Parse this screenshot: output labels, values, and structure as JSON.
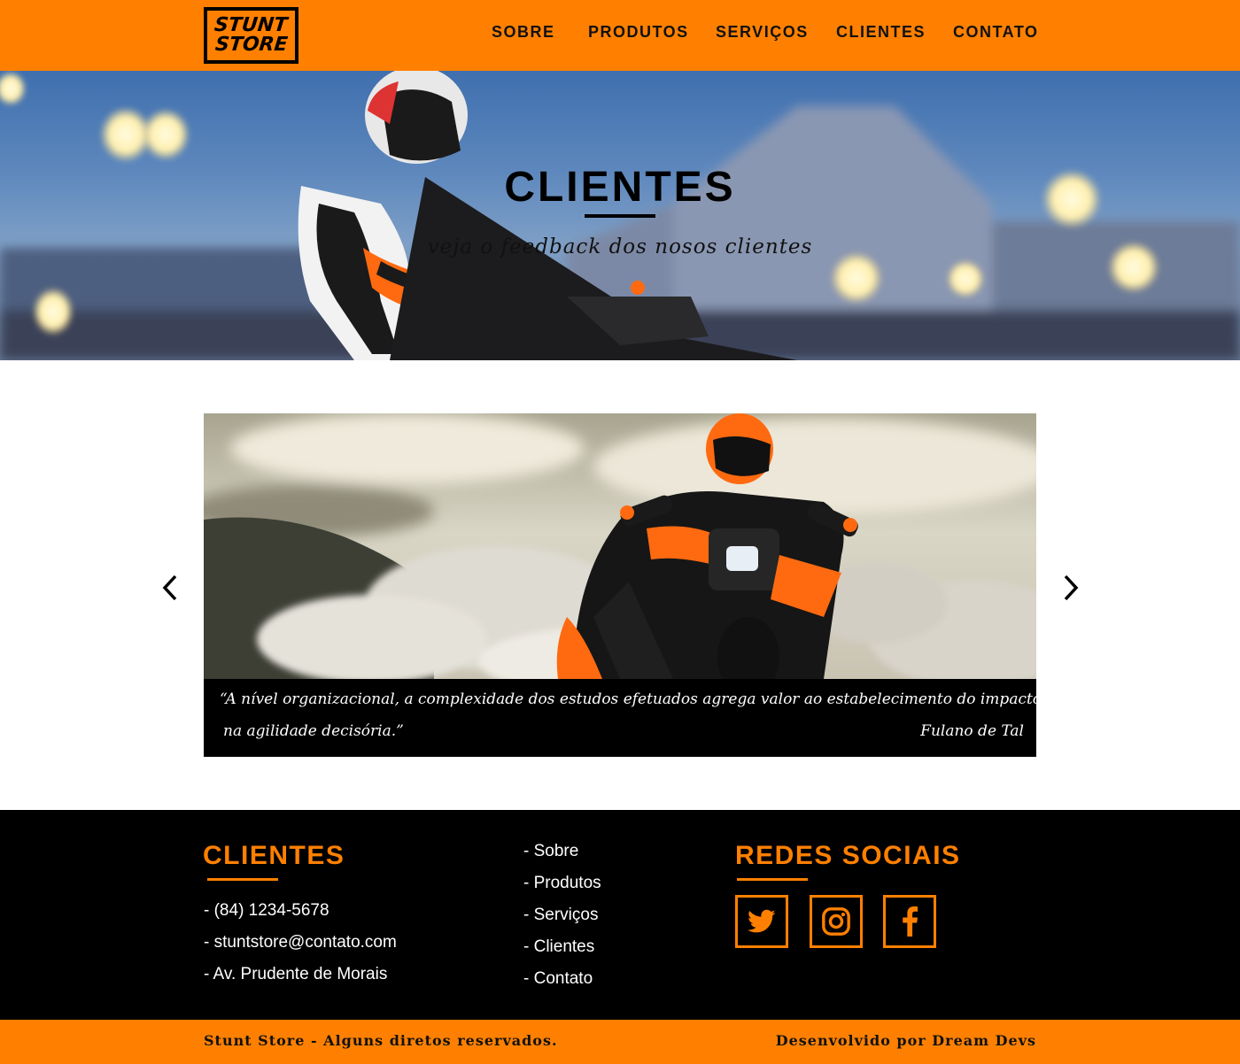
{
  "header": {
    "logo_line1": "STUNT",
    "logo_line2": "STORE",
    "nav": [
      "SOBRE",
      "PRODUTOS",
      "SERVIÇOS",
      "CLIENTES",
      "CONTATO"
    ]
  },
  "hero": {
    "title": "CLIENTES",
    "subtitle": "veja o feedback dos nosos clientes"
  },
  "testimonial": {
    "quote_line1": "“A nível organizacional, a complexidade dos estudos efetuados agrega valor ao estabelecimento do impacto",
    "quote_line2": "na agilidade decisória.”",
    "author": "Fulano de Tal",
    "prev_icon": "chevron-left-icon",
    "next_icon": "chevron-right-icon"
  },
  "footer": {
    "contact_title": "CLIENTES",
    "contacts": [
      "- (84) 1234-5678",
      "- stuntstore@contato.com",
      "- Av. Prudente de Morais"
    ],
    "links": [
      "- Sobre",
      "- Produtos",
      "- Serviços",
      "- Clientes",
      "- Contato"
    ],
    "social_title": "REDES SOCIAIS",
    "social_icons": [
      "twitter-icon",
      "instagram-icon",
      "facebook-icon"
    ]
  },
  "bottom_bar": {
    "copyright": "Stunt Store - Alguns diretos reservados.",
    "credits": "Desenvolvido por Dream Devs"
  },
  "colors": {
    "accent": "#ff8000",
    "dark": "#000000",
    "light": "#ffffff"
  }
}
